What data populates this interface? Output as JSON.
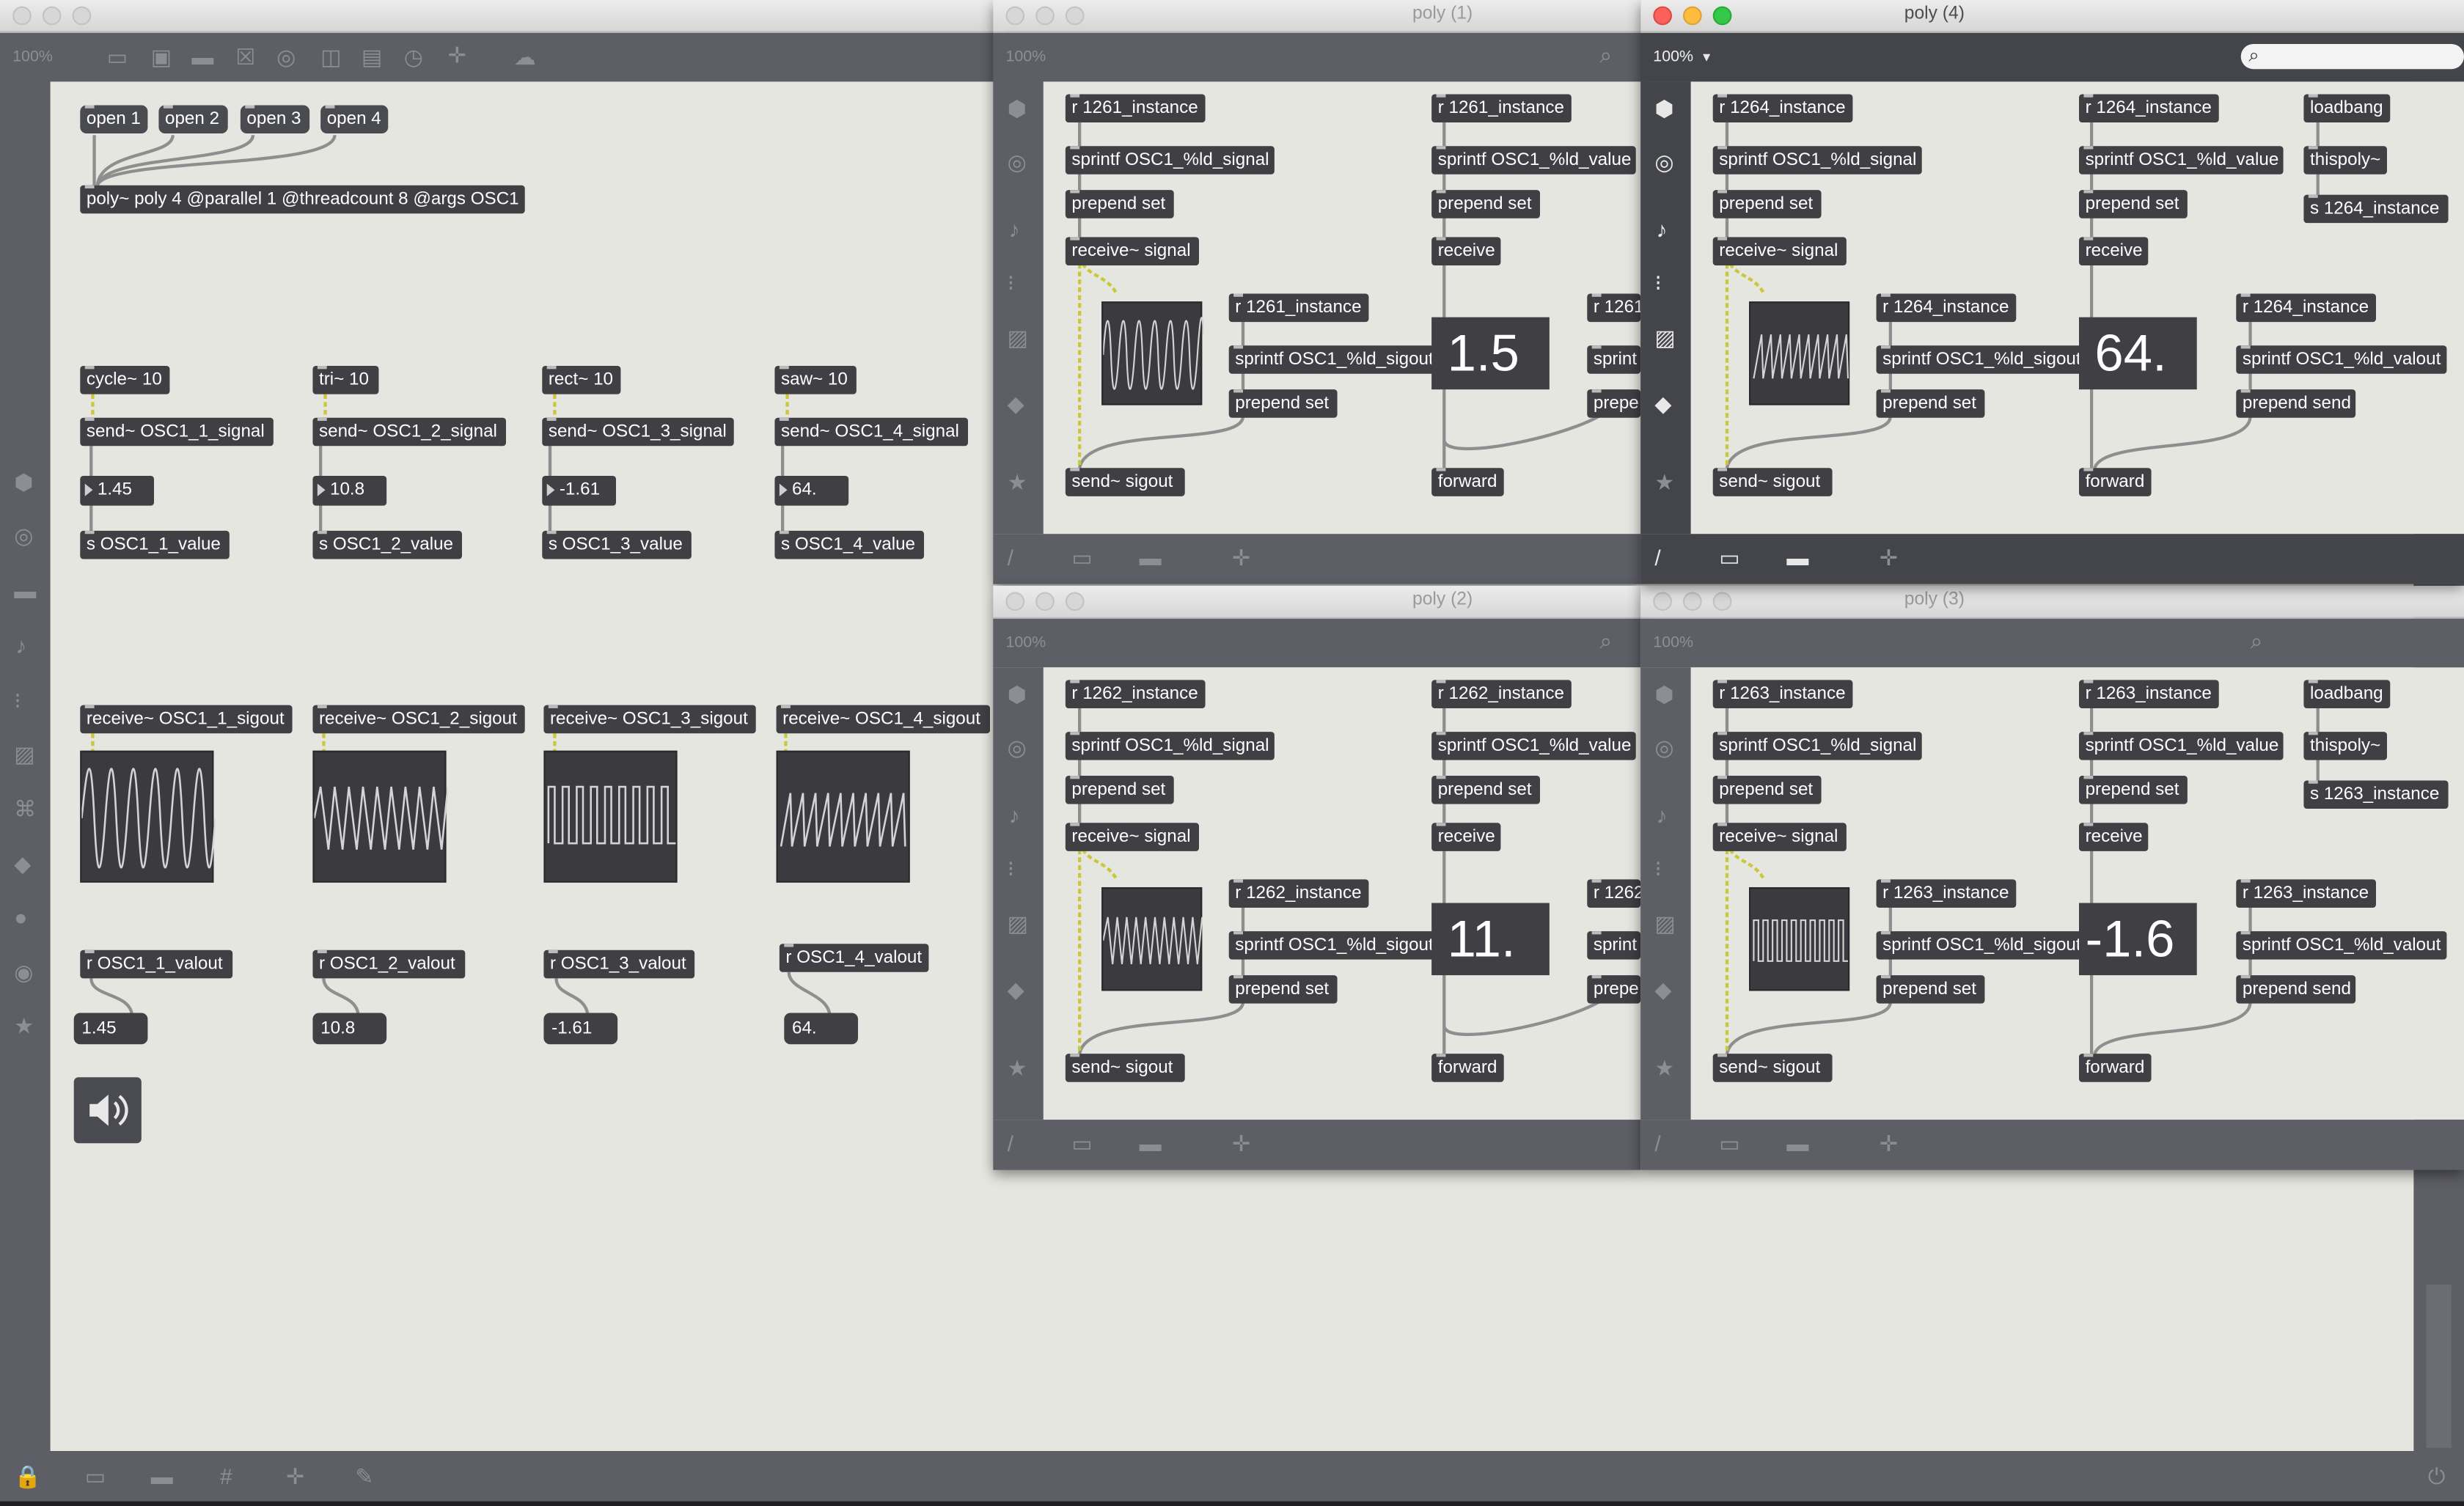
{
  "main": {
    "zoom": "100%",
    "open_buttons": [
      "open 1",
      "open 2",
      "open 3",
      "open 4"
    ],
    "poly_object": "poly~ poly 4 @parallel 1 @threadcount 8 @args OSC1",
    "osc_objects": [
      "cycle~ 10",
      "tri~ 10",
      "rect~ 10",
      "saw~ 10"
    ],
    "send_signals": [
      "send~ OSC1_1_signal",
      "send~ OSC1_2_signal",
      "send~ OSC1_3_signal",
      "send~ OSC1_4_signal"
    ],
    "number_boxes": [
      "1.45",
      "10.8",
      "-1.61",
      "64."
    ],
    "send_values": [
      "s OSC1_1_value",
      "s OSC1_2_value",
      "s OSC1_3_value",
      "s OSC1_4_value"
    ],
    "receive_sigouts": [
      "receive~ OSC1_1_sigout",
      "receive~ OSC1_2_sigout",
      "receive~ OSC1_3_sigout",
      "receive~ OSC1_4_sigout"
    ],
    "r_valouts": [
      "r OSC1_1_valout",
      "r OSC1_2_valout",
      "r OSC1_3_valout",
      "r OSC1_4_valout"
    ],
    "valout_boxes": [
      "1.45",
      "10.8",
      "-1.61",
      "64."
    ],
    "speaker_icon": "speaker-icon"
  },
  "windows": [
    {
      "id": "poly1",
      "title": "poly (1)",
      "zoom": "100%",
      "r_instance": "r 1261_instance",
      "sprintf_signal": "sprintf OSC1_%ld_signal",
      "prepend_set": "prepend set",
      "receive_signal": "receive~ signal",
      "r_instance_2": "r 1261_instance",
      "sprintf_sigout": "sprintf OSC1_%ld_sigout",
      "prepend_set_2": "prepend set",
      "send_sigout": "send~ sigout",
      "sprintf_value": "sprintf OSC1_%ld_value",
      "prepend_set_3": "prepend set",
      "receive": "receive",
      "big_number": "1.5",
      "forward": "forward",
      "r_instance_partial": "r 1261",
      "sprintf_partial": "sprint",
      "prepend_partial": "prepe"
    },
    {
      "id": "poly4",
      "title": "poly (4)",
      "zoom": "100%",
      "r_instance": "r 1264_instance",
      "sprintf_signal": "sprintf OSC1_%ld_signal",
      "prepend_set": "prepend set",
      "receive_signal": "receive~ signal",
      "r_instance_2": "r 1264_instance",
      "sprintf_sigout": "sprintf OSC1_%ld_sigout",
      "prepend_set_2": "prepend set",
      "send_sigout": "send~ sigout",
      "sprintf_value": "sprintf OSC1_%ld_value",
      "prepend_set_3": "prepend set",
      "receive": "receive",
      "big_number": "64.",
      "forward": "forward",
      "r_instance_3": "r 1264_instance",
      "sprintf_valout": "sprintf OSC1_%ld_valout",
      "prepend_send": "prepend send",
      "loadbang": "loadbang",
      "thispoly": "thispoly~",
      "s_instance": "s 1264_instance"
    },
    {
      "id": "poly2",
      "title": "poly (2)",
      "zoom": "100%",
      "r_instance": "r 1262_instance",
      "sprintf_signal": "sprintf OSC1_%ld_signal",
      "prepend_set": "prepend set",
      "receive_signal": "receive~ signal",
      "r_instance_2": "r 1262_instance",
      "sprintf_sigout": "sprintf OSC1_%ld_sigout",
      "prepend_set_2": "prepend set",
      "send_sigout": "send~ sigout",
      "sprintf_value": "sprintf OSC1_%ld_value",
      "prepend_set_3": "prepend set",
      "receive": "receive",
      "big_number": "11.",
      "forward": "forward",
      "r_instance_partial": "r 1262",
      "sprintf_partial": "sprint",
      "prepend_partial": "prepe"
    },
    {
      "id": "poly3",
      "title": "poly (3)",
      "zoom": "100%",
      "r_instance": "r 1263_instance",
      "sprintf_signal": "sprintf OSC1_%ld_signal",
      "prepend_set": "prepend set",
      "receive_signal": "receive~ signal",
      "r_instance_2": "r 1263_instance",
      "sprintf_sigout": "sprintf OSC1_%ld_sigout",
      "prepend_set_2": "prepend set",
      "send_sigout": "send~ sigout",
      "sprintf_value": "sprintf OSC1_%ld_value",
      "prepend_set_3": "prepend set",
      "receive": "receive",
      "big_number": "-1.6",
      "forward": "forward",
      "r_instance_3": "r 1263_instance",
      "sprintf_valout": "sprintf OSC1_%ld_valout",
      "prepend_send": "prepend send",
      "loadbang": "loadbang",
      "thispoly": "thispoly~",
      "s_instance": "s 1263_instance"
    }
  ],
  "colors": {
    "canvas": "#e6e6e0",
    "object": "#3f3f44",
    "toolbar": "#5d5e66",
    "signal_patchcord": "#c8c83a",
    "patchcord": "#9a9a9a",
    "close": "#fc605b",
    "minimize": "#fdbc40",
    "zoom": "#34c84a"
  }
}
